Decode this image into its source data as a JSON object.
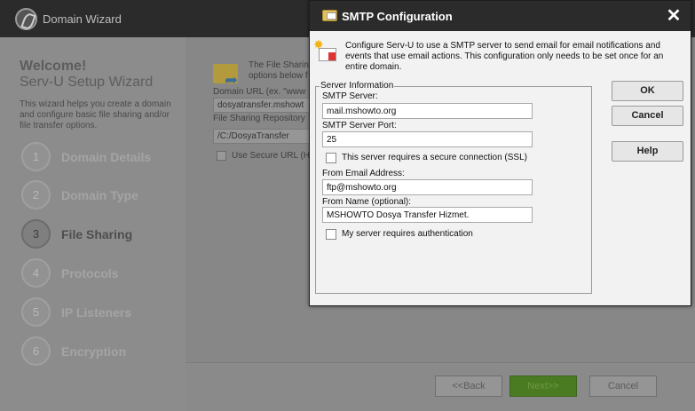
{
  "wizard": {
    "title": "Domain Wizard",
    "welcome": "Welcome!",
    "subtitle": "Serv-U Setup Wizard",
    "description": "This wizard helps you create a domain and configure basic file sharing and/or file transfer options.",
    "steps": [
      {
        "num": "1",
        "label": "Domain Details"
      },
      {
        "num": "2",
        "label": "Domain Type"
      },
      {
        "num": "3",
        "label": "File Sharing"
      },
      {
        "num": "4",
        "label": "Protocols"
      },
      {
        "num": "5",
        "label": "IP Listeners"
      },
      {
        "num": "6",
        "label": "Encryption"
      }
    ],
    "panel": {
      "intro_line1": "The File Sharin",
      "intro_line2": "options below f",
      "domain_url_label": "Domain URL (ex. \"www",
      "domain_url_value": "dosyatransfer.mshowt",
      "repository_label": "File Sharing Repository",
      "repository_value": "/C:/DosyaTransfer",
      "secure_url_label": "Use Secure URL (H"
    },
    "footer": {
      "back": "<<Back",
      "next": "Next>>",
      "cancel": "Cancel"
    }
  },
  "dialog": {
    "title": "SMTP Configuration",
    "close_glyph": "✕",
    "description": "Configure Serv-U to use a SMTP server to send email for email notifications and events that use email actions. This configuration only needs to be set once for an entire domain.",
    "group_label": "Server Information",
    "smtp_server_label": "SMTP Server:",
    "smtp_server_value": "mail.mshowto.org",
    "smtp_port_label": "SMTP Server Port:",
    "smtp_port_value": "25",
    "ssl_label": "This server requires a secure connection (SSL)",
    "from_email_label": "From Email Address:",
    "from_email_value": "ftp@mshowto.org",
    "from_name_label": "From Name (optional):",
    "from_name_value": "MSHOWTO Dosya Transfer Hizmet.",
    "auth_label": "My server requires authentication",
    "buttons": {
      "ok": "OK",
      "cancel": "Cancel",
      "help": "Help"
    }
  }
}
